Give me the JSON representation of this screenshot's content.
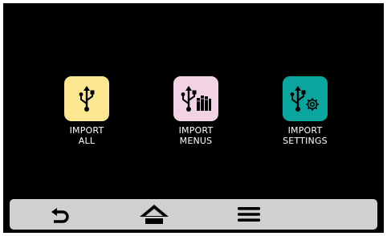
{
  "tiles": [
    {
      "id": "import-all",
      "line1": "IMPORT",
      "line2": "ALL",
      "color": "#fbe78f",
      "icon": "usb-icon"
    },
    {
      "id": "import-menus",
      "line1": "IMPORT",
      "line2": "MENUS",
      "color": "#f2d3e4",
      "icon": "usb-books-icon"
    },
    {
      "id": "import-settings",
      "line1": "IMPORT",
      "line2": "SETTINGS",
      "color": "#0aa69e",
      "icon": "usb-gear-icon"
    }
  ],
  "navbar": {
    "back_icon": "back-arrow-icon",
    "home_icon": "home-icon",
    "menu_icon": "hamburger-menu-icon"
  },
  "colors": {
    "screen_background": "#000000",
    "navbar_background": "#d0d0d0",
    "label_text": "#ffffff"
  }
}
